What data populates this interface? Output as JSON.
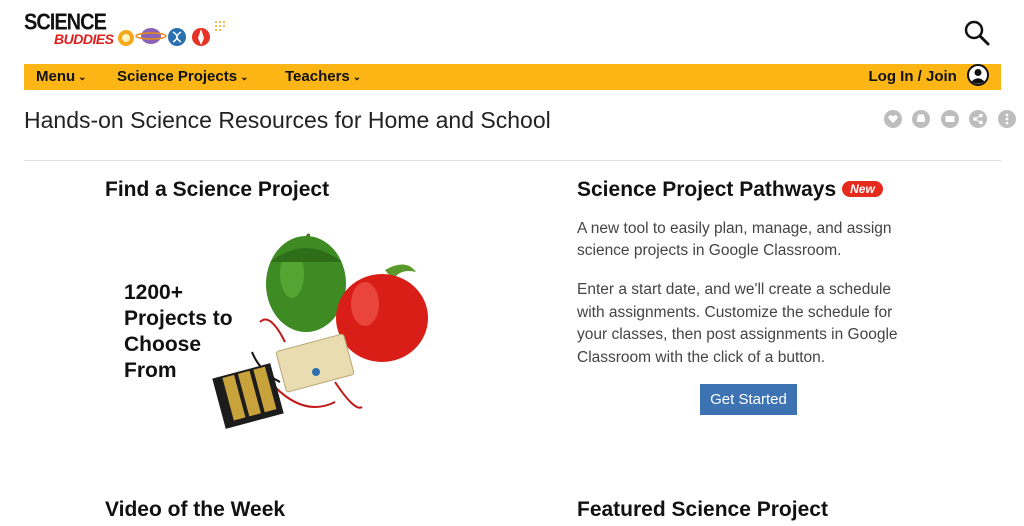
{
  "header": {
    "logo_line1": "SCIENCE",
    "logo_line2": "BUDDIES",
    "search_icon": "search-icon"
  },
  "nav": {
    "items": [
      {
        "label": "Menu"
      },
      {
        "label": "Science Projects"
      },
      {
        "label": "Teachers"
      }
    ],
    "login_label": "Log In / Join",
    "bar_color": "#fbb616"
  },
  "page": {
    "title": "Hands-on Science Resources for Home and School",
    "share_icons": [
      "heart-icon",
      "print-icon",
      "email-icon",
      "share-icon",
      "more-icon"
    ]
  },
  "find_project": {
    "title": "Find a Science Project",
    "image_text": "1200+\nProjects to\nChoose\nFrom"
  },
  "pathways": {
    "title": "Science Project Pathways",
    "badge": "New",
    "desc1": "A new tool to easily plan, manage, and assign science projects in Google Classroom.",
    "desc2": "Enter a start date, and we'll create a schedule with assignments. Customize the schedule for your classes, then post assignments in Google Classroom with the click of a button.",
    "button_label": "Get Started",
    "button_color": "#3d73b3",
    "badge_color": "#e62b1e"
  },
  "bottom": {
    "video_title": "Video of the Week",
    "featured_title": "Featured Science Project"
  }
}
